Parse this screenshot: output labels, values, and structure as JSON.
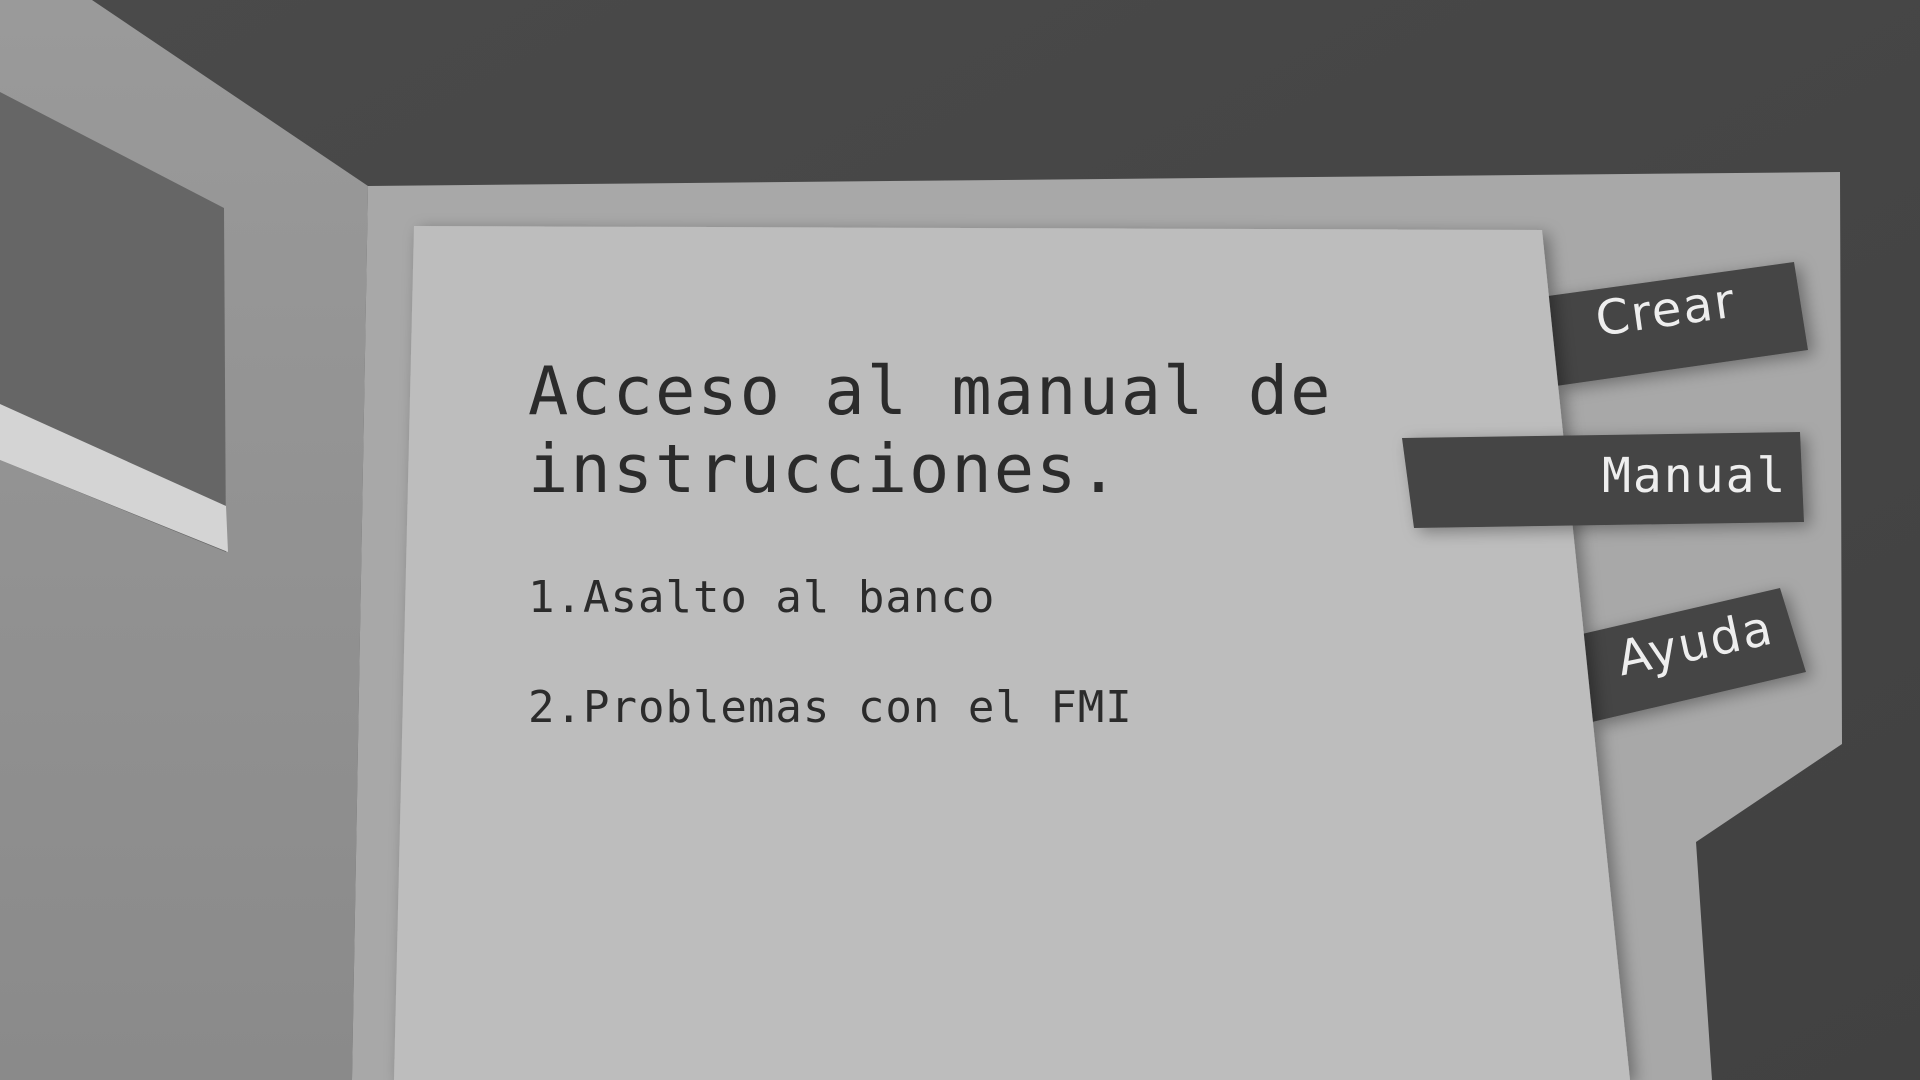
{
  "page": {
    "title_line_1": "Acceso al manual de",
    "title_line_2": "instrucciones."
  },
  "manual": {
    "items": [
      {
        "label": "1.Asalto al banco"
      },
      {
        "label": "2.Problemas con el FMI"
      }
    ]
  },
  "tabs": [
    {
      "label": "Crear"
    },
    {
      "label": "Manual"
    },
    {
      "label": "Ayuda"
    }
  ],
  "colors": {
    "wall_dark": "#444444",
    "panel": "#a8a8a8",
    "paper": "#bdbdbd",
    "tab": "#454545",
    "text": "#2b2b2b",
    "tab_text": "#eeeeee"
  }
}
